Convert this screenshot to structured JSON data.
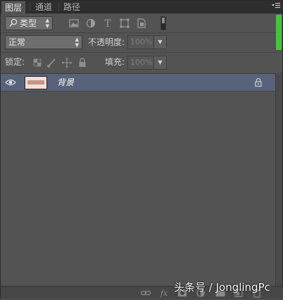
{
  "tabs": [
    {
      "label": "图层",
      "active": true
    },
    {
      "label": "通道",
      "active": false
    },
    {
      "label": "路径",
      "active": false
    }
  ],
  "filter": {
    "kind_label": "类型",
    "search_icon": "search-icon"
  },
  "blend": {
    "mode": "正常",
    "opacity_label": "不透明度:",
    "opacity_value": "100%"
  },
  "lock": {
    "label": "锁定:",
    "fill_label": "填充:",
    "fill_value": "100%"
  },
  "layers": [
    {
      "name": "背景",
      "visible": true,
      "locked": true
    }
  ],
  "watermark": "头条号 / JonglingPc",
  "colors": {
    "panel_bg": "#535353",
    "selected_layer": "#58627a",
    "accent_green": "#42c53a"
  }
}
